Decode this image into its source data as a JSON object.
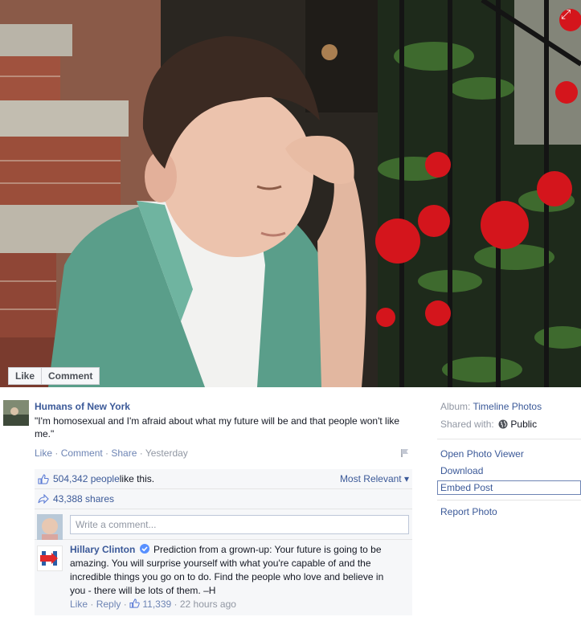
{
  "photo": {
    "like_label": "Like",
    "comment_label": "Comment",
    "expand_icon": "expand-icon"
  },
  "post": {
    "poster_name": "Humans of New York",
    "caption": "\"I'm homosexual and I'm afraid about what my future will be and that people won't like me.\"",
    "actions": {
      "like": "Like",
      "comment": "Comment",
      "share": "Share",
      "time": "Yesterday"
    },
    "likes_count": "504,342 people",
    "likes_suffix": " like this.",
    "sort_label": "Most Relevant",
    "shares": "43,388 shares",
    "comment_placeholder": "Write a comment..."
  },
  "comment": {
    "author": "Hillary Clinton",
    "text": "Prediction from a grown-up: Your future is going to be amazing. You will surprise yourself with what you're capable of and the incredible things you go on to do. Find the people who love and believe in you - there will be lots of them. –H",
    "like": "Like",
    "reply": "Reply",
    "likes": "11,339",
    "time": "22 hours ago"
  },
  "sidebar": {
    "album_label": "Album:",
    "album_value": "Timeline Photos",
    "shared_label": "Shared with:",
    "shared_value": "Public",
    "open_viewer": "Open Photo Viewer",
    "download": "Download",
    "embed": "Embed Post",
    "report": "Report Photo"
  },
  "colors": {
    "link": "#3b5998",
    "muted": "#9197a3",
    "ufi_bg": "#f6f7f9",
    "flowers": "#d4151c"
  }
}
